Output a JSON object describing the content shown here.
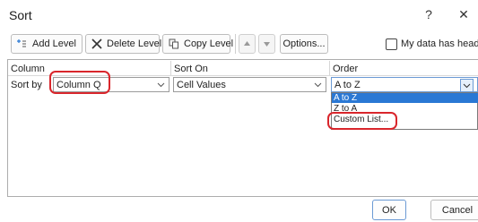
{
  "dialog": {
    "title": "Sort",
    "help_glyph": "?",
    "close_glyph": "✕"
  },
  "toolbar": {
    "add_level": "Add Level",
    "delete_level": "Delete Level",
    "copy_level": "Copy Level",
    "options": "Options...",
    "my_data_has_headers": "My data has header"
  },
  "columns": {
    "column": "Column",
    "sort_on": "Sort On",
    "order": "Order"
  },
  "row": {
    "label": "Sort by",
    "column_value": "Column Q",
    "sort_on_value": "Cell Values",
    "order_value": "A to Z"
  },
  "order_options": [
    "A to Z",
    "Z to A",
    "Custom List..."
  ],
  "selected_option_index": 0,
  "buttons": {
    "ok": "OK",
    "cancel": "Cancel"
  },
  "colors": {
    "highlight": "#d9262c",
    "selection": "#2a78d4"
  },
  "icons": [
    "add-level-icon",
    "delete-level-icon",
    "copy-level-icon",
    "move-up-icon",
    "move-down-icon",
    "chevron-down-icon"
  ]
}
